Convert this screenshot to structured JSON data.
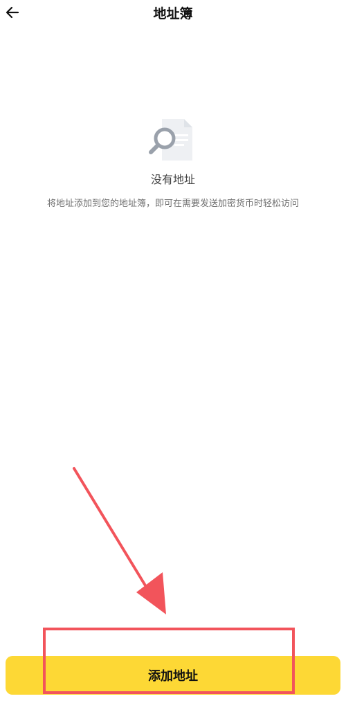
{
  "header": {
    "title": "地址簿",
    "back_icon": "arrow-left-icon"
  },
  "empty_state": {
    "icon": "document-search-icon",
    "title": "没有地址",
    "description": "将地址添加到您的地址簿，即可在需要发送加密货币时轻松访问"
  },
  "footer": {
    "add_button_label": "添加地址"
  },
  "colors": {
    "accent": "#fdd835",
    "annotation": "#f2545b"
  }
}
